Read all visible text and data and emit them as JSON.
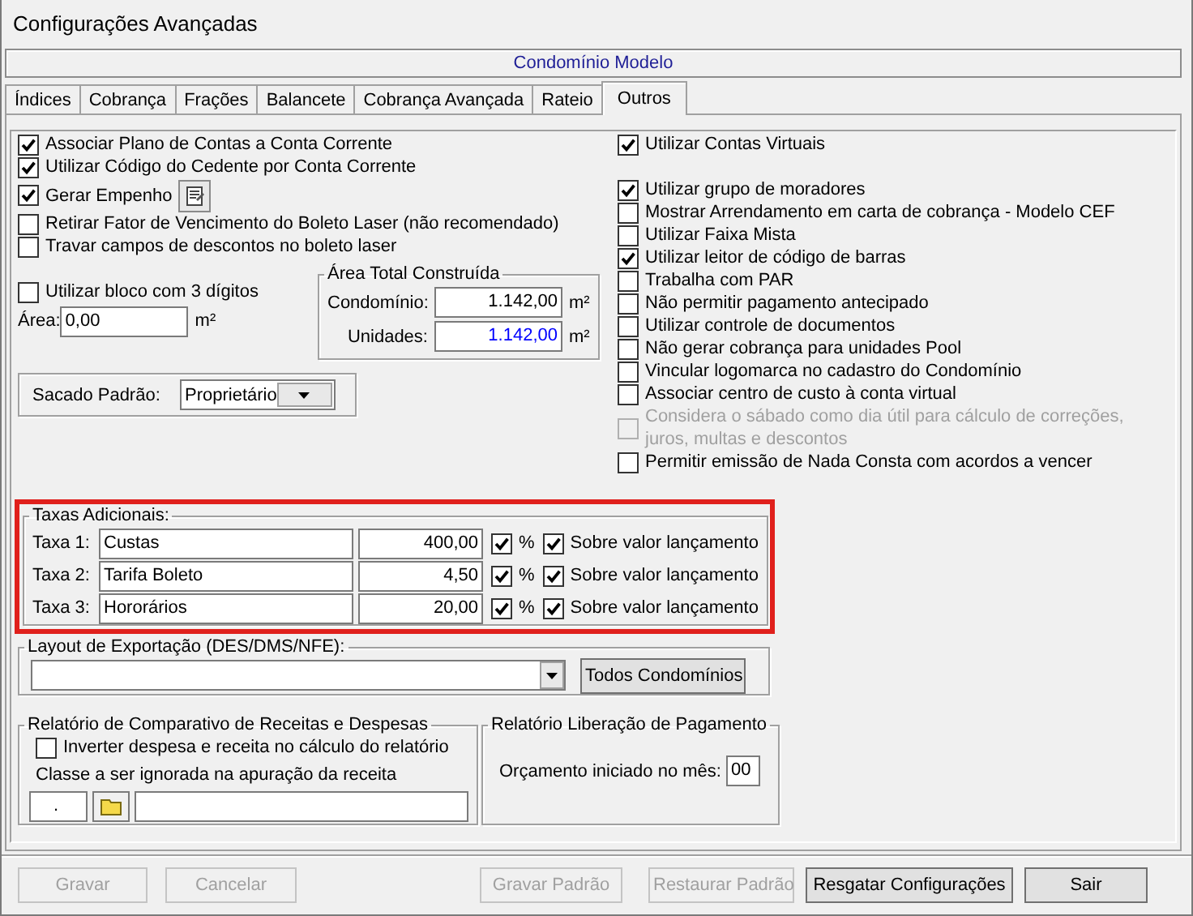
{
  "window": {
    "title": "Configurações Avançadas"
  },
  "header": {
    "title": "Condomínio Modelo"
  },
  "tabs": [
    {
      "label": "Índices",
      "selected": false
    },
    {
      "label": "Cobrança",
      "selected": false
    },
    {
      "label": "Frações",
      "selected": false
    },
    {
      "label": "Balancete",
      "selected": false
    },
    {
      "label": "Cobrança Avançada",
      "selected": false
    },
    {
      "label": "Rateio",
      "selected": false
    },
    {
      "label": "Outros",
      "selected": true
    }
  ],
  "left_options": [
    {
      "kind": "check",
      "label": "Associar Plano de Contas a Conta Corrente",
      "checked": true
    },
    {
      "kind": "check",
      "label": "Utilizar Código do Cedente por Conta Corrente",
      "checked": true
    },
    {
      "kind": "with_button",
      "label": "Gerar Empenho",
      "checked": true
    },
    {
      "kind": "check",
      "label": "Retirar Fator de Vencimento do Boleto Laser (não recomendado)",
      "checked": false
    },
    {
      "kind": "check",
      "label": "Travar campos de descontos no boleto laser",
      "checked": false
    }
  ],
  "bloco": {
    "label": "Utilizar bloco com 3 dígitos",
    "checked": false
  },
  "area": {
    "label": "Área:",
    "value": "0,00",
    "unit": "m²"
  },
  "area_total": {
    "title": "Área Total Construída",
    "fields": [
      {
        "label": "Condomínio:",
        "value": "1.142,00",
        "unit": "m²",
        "color": "#000000"
      },
      {
        "label": "Unidades:",
        "value": "1.142,00",
        "unit": "m²",
        "color": "#0000ff"
      }
    ]
  },
  "sacado": {
    "label": "Sacado Padrão:",
    "value": "Proprietário"
  },
  "right_options": [
    {
      "label": "Utilizar Contas Virtuais",
      "checked": true,
      "disabled": false
    },
    {
      "label": "Utilizar grupo de moradores",
      "checked": true,
      "disabled": false
    },
    {
      "label": "Mostrar Arrendamento em carta de cobrança - Modelo CEF",
      "checked": false,
      "disabled": false
    },
    {
      "label": "Utilizar Faixa Mista",
      "checked": false,
      "disabled": false
    },
    {
      "label": "Utilizar leitor de código de barras",
      "checked": true,
      "disabled": false
    },
    {
      "label": "Trabalha com PAR",
      "checked": false,
      "disabled": false
    },
    {
      "label": "Não permitir pagamento antecipado",
      "checked": false,
      "disabled": false
    },
    {
      "label": "Utilizar controle de documentos",
      "checked": false,
      "disabled": false
    },
    {
      "label": "Não gerar cobrança para unidades Pool",
      "checked": false,
      "disabled": false
    },
    {
      "label": "Vincular logomarca no cadastro do Condomínio",
      "checked": false,
      "disabled": false
    },
    {
      "label": "Associar centro de custo à conta virtual",
      "checked": false,
      "disabled": false
    },
    {
      "label": "Considera o sábado como dia útil para cálculo de correções, juros, multas e descontos",
      "checked": false,
      "disabled": true
    },
    {
      "label": "Permitir emissão de Nada Consta com acordos a vencer",
      "checked": false,
      "disabled": false
    }
  ],
  "taxas": {
    "title": "Taxas Adicionais:",
    "highlighted": true,
    "rows": [
      {
        "label": "Taxa 1:",
        "name": "Custas",
        "value": "400,00",
        "percent": true,
        "percent_label": "%",
        "sobre": true,
        "sobre_label": "Sobre valor lançamento"
      },
      {
        "label": "Taxa 2:",
        "name": "Tarifa Boleto",
        "value": "4,50",
        "percent": true,
        "percent_label": "%",
        "sobre": true,
        "sobre_label": "Sobre valor lançamento"
      },
      {
        "label": "Taxa 3:",
        "name": "Hororários",
        "value": "20,00",
        "percent": true,
        "percent_label": "%",
        "sobre": true,
        "sobre_label": "Sobre valor lançamento"
      }
    ]
  },
  "layout_exportacao": {
    "title": "Layout de Exportação (DES/DMS/NFE):",
    "button": "Todos Condomínios"
  },
  "relatorio_comparativo": {
    "title": "Relatório de Comparativo de Receitas e Despesas",
    "option": {
      "label": "Inverter despesa e receita no cálculo do relatório",
      "checked": false
    },
    "class_label": "Classe a ser ignorada na apuração da receita",
    "class_code": "."
  },
  "relatorio_liberacao": {
    "title": "Relatório Liberação de Pagamento",
    "label": "Orçamento iniciado no mês:",
    "value": "00"
  },
  "buttons": [
    {
      "label": "Gravar",
      "disabled": true
    },
    {
      "label": "Cancelar",
      "disabled": true
    },
    {
      "label": "Gravar Padrão",
      "disabled": true
    },
    {
      "label": "Restaurar Padrão",
      "disabled": true
    },
    {
      "label": "Resgatar Configurações",
      "disabled": false
    },
    {
      "label": "Sair",
      "disabled": false
    }
  ]
}
